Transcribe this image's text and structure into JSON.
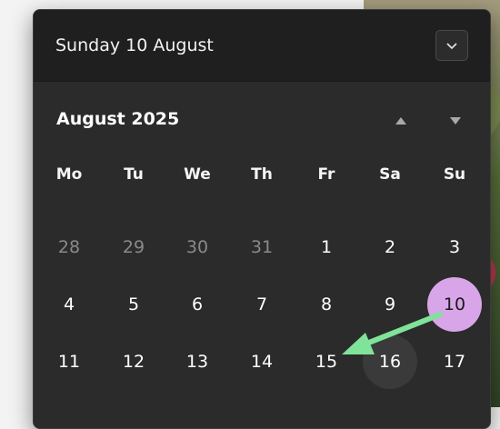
{
  "header": {
    "full_date": "Sunday 10 August"
  },
  "calendar": {
    "month_label": "August 2025",
    "weekdays": [
      "Mo",
      "Tu",
      "We",
      "Th",
      "Fr",
      "Sa",
      "Su"
    ],
    "weeks": [
      [
        "28",
        "29",
        "30",
        "31",
        "1",
        "2",
        "3"
      ],
      [
        "4",
        "5",
        "6",
        "7",
        "8",
        "9",
        "10"
      ],
      [
        "11",
        "12",
        "13",
        "14",
        "15",
        "16",
        "17"
      ]
    ],
    "muted_days": [
      "28",
      "29",
      "30",
      "31"
    ],
    "selected_day": "10",
    "hover_day": "16"
  },
  "icons": {
    "collapse": "chevron-down-icon",
    "prev_month": "caret-up-icon",
    "next_month": "caret-down-icon"
  },
  "colors": {
    "selected_fill": "#d8a6e8",
    "annotation_arrow": "#7fe39a",
    "flyout_bg": "#2b2b2b"
  }
}
